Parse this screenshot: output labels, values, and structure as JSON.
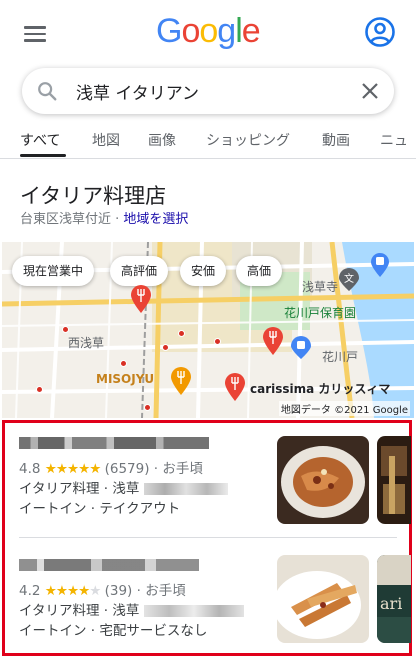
{
  "header": {
    "logo_letters": [
      "G",
      "o",
      "o",
      "g",
      "l",
      "e"
    ]
  },
  "search": {
    "query": "浅草 イタリアン",
    "placeholder": ""
  },
  "tabs": [
    {
      "label": "すべて"
    },
    {
      "label": "地図"
    },
    {
      "label": "画像"
    },
    {
      "label": "ショッピング"
    },
    {
      "label": "動画"
    },
    {
      "label": "ニュ"
    }
  ],
  "section": {
    "title": "イタリア料理店",
    "location_prefix": "台東区浅草付近 · ",
    "location_link": "地域を選択"
  },
  "map": {
    "chips": [
      "現在営業中",
      "高評価",
      "安価",
      "高価"
    ],
    "labels": {
      "asakusa_temple": "浅草寺",
      "hanakawado_school": "花川戸保育園",
      "nishi_asakusa": "西浅草",
      "hanakawado": "花川戸",
      "misojyu": "MISOJYU",
      "carissima": "carissima カリッスィマ"
    },
    "credit": "地図データ ©2021 Google"
  },
  "results": [
    {
      "rating": "4.8",
      "stars": "★★★★★",
      "reviews": "(6579)",
      "price": "· お手頃",
      "category": "イタリア料理 · 浅草",
      "services": "イートイン · テイクアウト"
    },
    {
      "rating": "4.2",
      "stars": "★★★★",
      "star_empty": "★",
      "reviews": "(39)",
      "price": "· お手頃",
      "category": "イタリア料理 · 浅草",
      "services": "イートイン · 宅配サービスなし"
    }
  ],
  "colors": {
    "link": "#1a0dab",
    "star": "#f4b400",
    "highlight_border": "#e0001a",
    "pin": "#d93025"
  },
  "icons": {
    "menu": "hamburger-icon",
    "account": "account-circle-icon",
    "search": "search-icon",
    "clear": "close-icon",
    "restaurant_pin": "fork-knife-pin-icon"
  }
}
